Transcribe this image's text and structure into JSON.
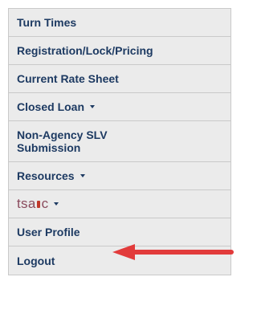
{
  "menu": {
    "items": [
      {
        "label": "Turn Times",
        "dropdown": false
      },
      {
        "label": "Registration/Lock/Pricing",
        "dropdown": false
      },
      {
        "label": "Current Rate Sheet",
        "dropdown": false
      },
      {
        "label": "Closed Loan",
        "dropdown": true
      },
      {
        "label": "Non-Agency SLV Submission",
        "dropdown": false
      },
      {
        "label": "Resources",
        "dropdown": true
      },
      {
        "label": "tsahc",
        "dropdown": true,
        "logo": true
      },
      {
        "label": "User Profile",
        "dropdown": false
      },
      {
        "label": "Logout",
        "dropdown": false
      }
    ],
    "logo_text_left": "tsa",
    "logo_text_right": "c"
  },
  "annotation": {
    "type": "arrow",
    "color": "#e23b3b",
    "points_to": "tsahc"
  },
  "colors": {
    "text": "#1d3a62",
    "item_bg": "#ebebeb",
    "border": "#c9c9c9",
    "logo": "#8a4a5c",
    "arrow": "#e23b3b"
  }
}
